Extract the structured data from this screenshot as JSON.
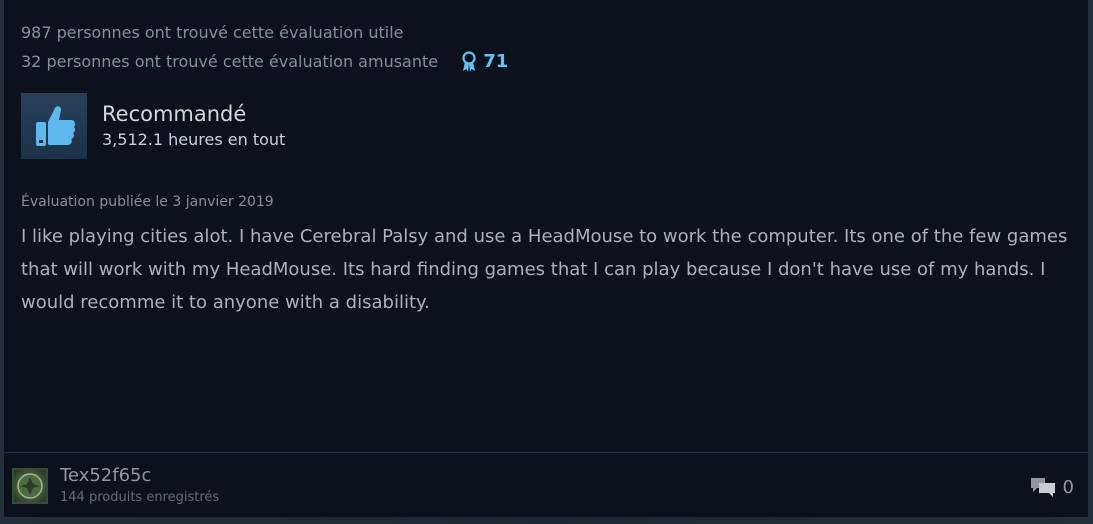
{
  "review": {
    "helpful_text": "987 personnes ont trouvé cette évaluation utile",
    "funny_text": "32 personnes ont trouvé cette évaluation amusante",
    "award_count": "71",
    "vote_title": "Recommandé",
    "hours": "3,512.1 heures en tout",
    "posted": "Évaluation publiée le 3 janvier 2019",
    "content": "I like playing cities alot. I have Cerebral Palsy and use a HeadMouse to work the computer. Its one of the few games that will work with my HeadMouse. Its hard finding games that I can play because I don't have use of my hands. I would recomme it to anyone with a disability."
  },
  "author": {
    "name": "Tex52f65c",
    "products": "144 produits enregistrés"
  },
  "comments": {
    "count": "0"
  },
  "icons": {
    "award": "award-ribbon-icon",
    "thumb": "thumbs-up-icon",
    "comment": "comment-bubble-icon"
  },
  "colors": {
    "accent": "#66c0f4",
    "card_bg": "#0c121b",
    "text": "#acb2b8"
  }
}
